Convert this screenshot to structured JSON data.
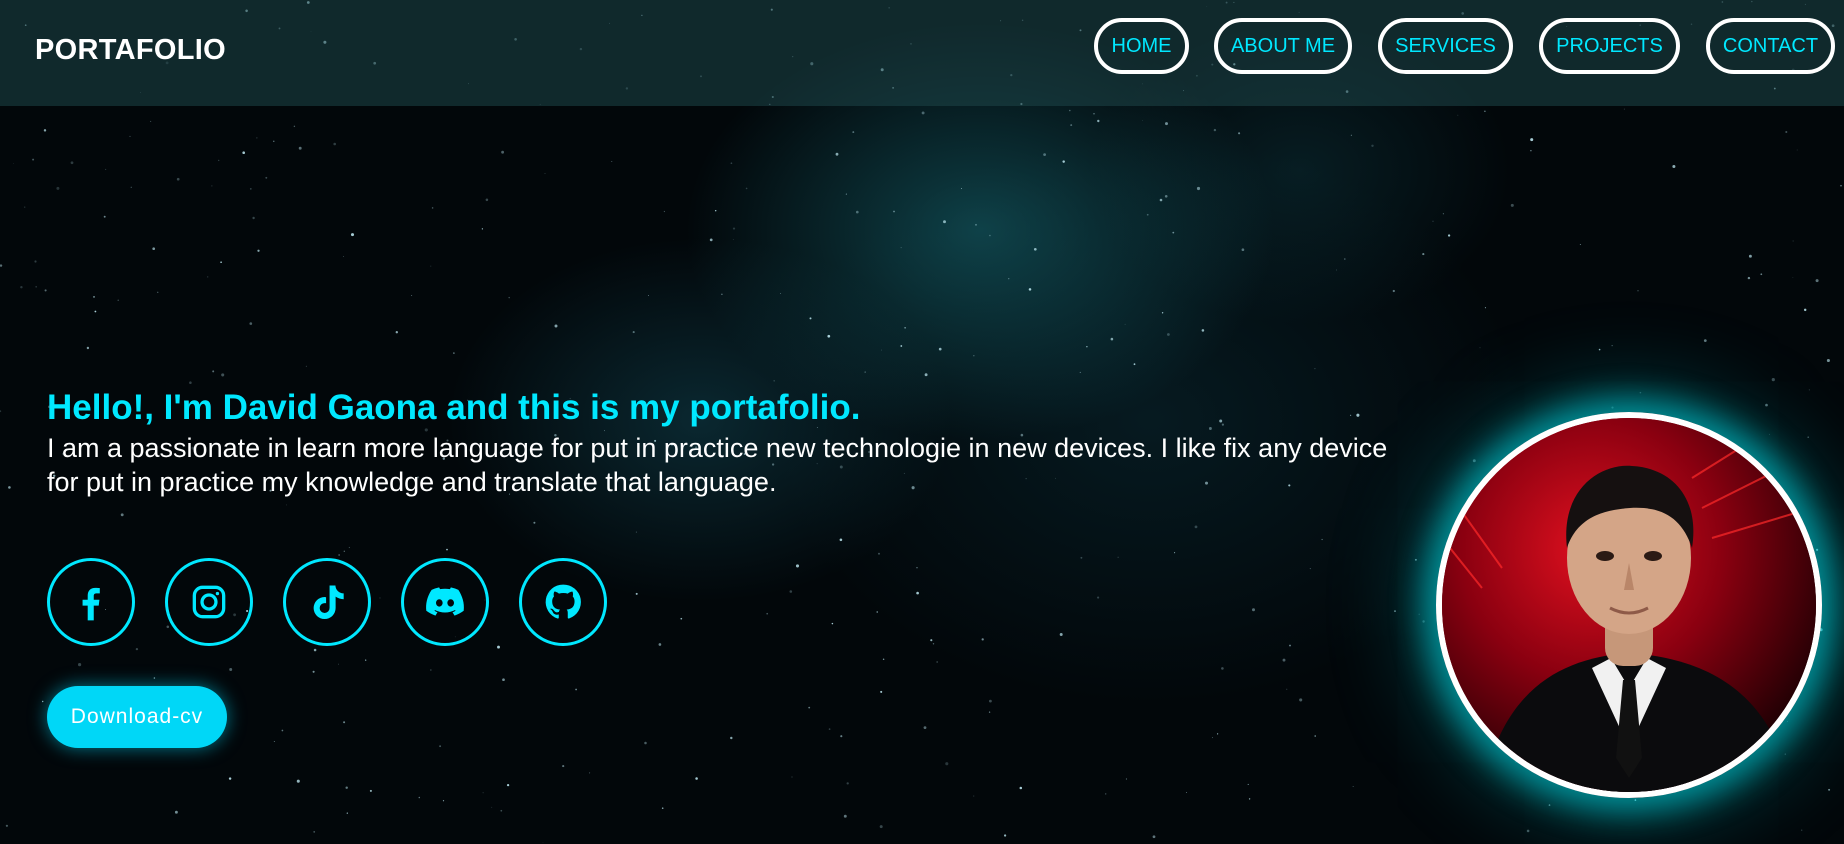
{
  "header": {
    "logo": "PORTAFOLIO",
    "nav": [
      {
        "label": "HOME"
      },
      {
        "label": "ABOUT ME"
      },
      {
        "label": "SERVICES"
      },
      {
        "label": "PROJECTS"
      },
      {
        "label": "CONTACT"
      }
    ]
  },
  "hero": {
    "title": "Hello!, I'm David Gaona and this is my portafolio.",
    "description": "I am a passionate in learn more language for put in practice new technologie in new devices. I like fix any device for put in practice my knowledge and translate that language.",
    "download_label": "Download-cv"
  },
  "socials": [
    {
      "icon": "facebook-icon"
    },
    {
      "icon": "instagram-icon"
    },
    {
      "icon": "tiktok-icon"
    },
    {
      "icon": "discord-icon"
    },
    {
      "icon": "github-icon"
    }
  ],
  "colors": {
    "accent": "#00e8ff",
    "button": "#00d7f7",
    "text": "#ffffff",
    "background": "#02070a"
  }
}
